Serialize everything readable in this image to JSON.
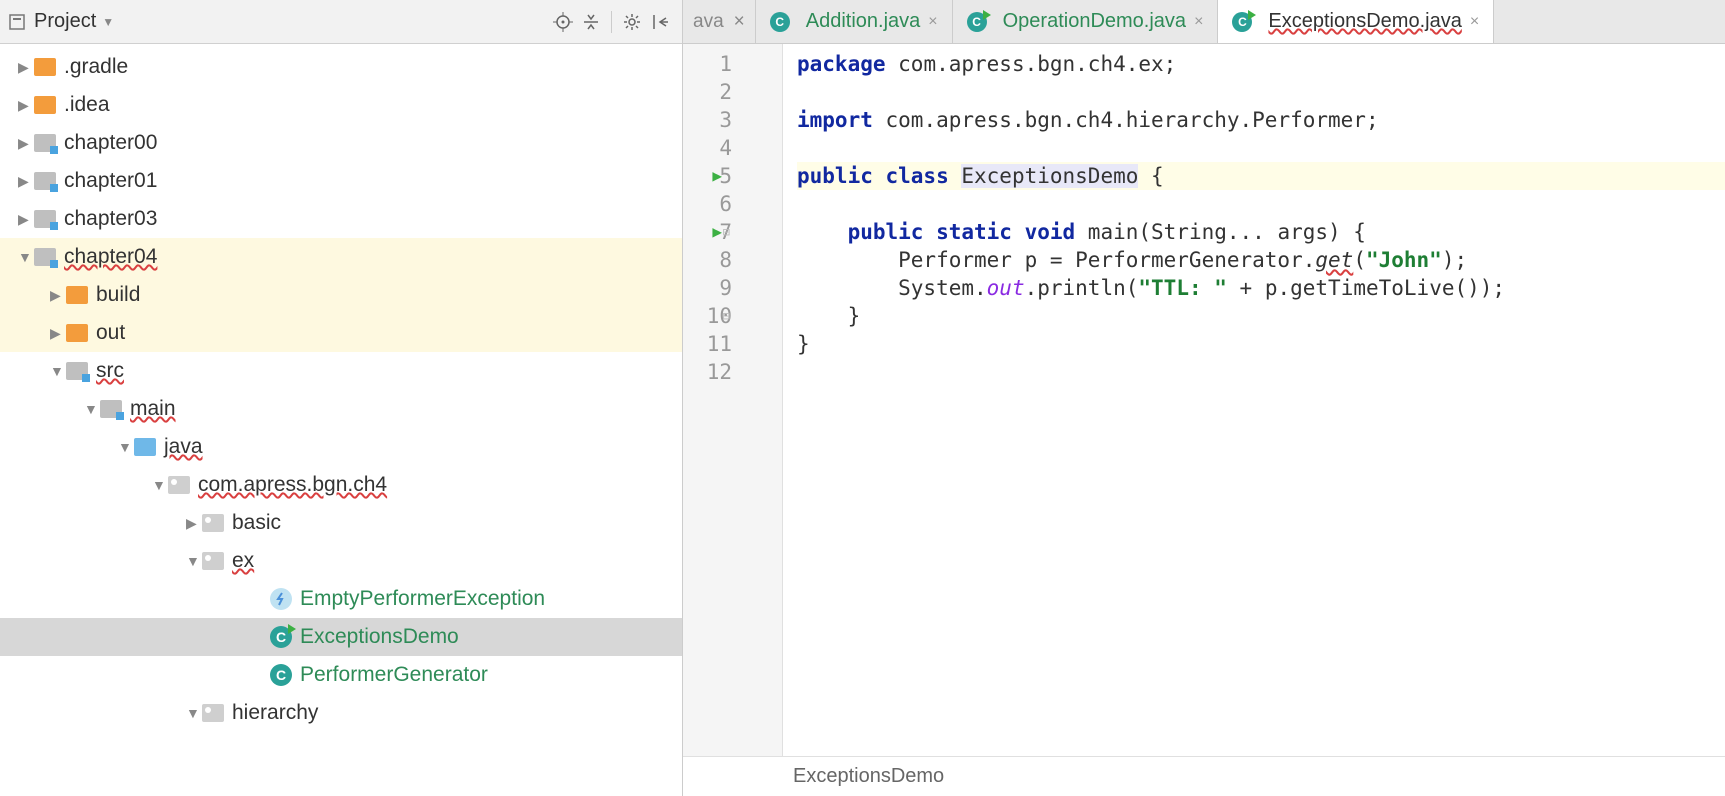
{
  "sidebar": {
    "title": "Project",
    "tree": [
      {
        "label": ".gradle",
        "icon": "folder-orange",
        "indent": 0,
        "expanded": false
      },
      {
        "label": ".idea",
        "icon": "folder-orange",
        "indent": 0,
        "expanded": false
      },
      {
        "label": "chapter00",
        "icon": "folder-gray",
        "indent": 0,
        "expanded": false
      },
      {
        "label": "chapter01",
        "icon": "folder-gray",
        "indent": 0,
        "expanded": false
      },
      {
        "label": "chapter03",
        "icon": "folder-gray",
        "indent": 0,
        "expanded": false
      },
      {
        "label": "chapter04",
        "icon": "folder-gray",
        "indent": 0,
        "expanded": true,
        "hl": true,
        "wavy": true
      },
      {
        "label": "build",
        "icon": "folder-orange",
        "indent": 1,
        "expanded": false,
        "hl": true
      },
      {
        "label": "out",
        "icon": "folder-orange",
        "indent": 1,
        "expanded": false,
        "hl": true
      },
      {
        "label": "src",
        "icon": "folder-gray",
        "indent": 1,
        "expanded": true,
        "wavy": true
      },
      {
        "label": "main",
        "icon": "folder-gray",
        "indent": 2,
        "expanded": true,
        "wavy": true
      },
      {
        "label": "java",
        "icon": "folder-blue",
        "indent": 3,
        "expanded": true,
        "wavy": true
      },
      {
        "label": "com.apress.bgn.ch4",
        "icon": "folder-pkg",
        "indent": 4,
        "expanded": true,
        "wavy": true
      },
      {
        "label": "basic",
        "icon": "folder-pkg",
        "indent": 5,
        "expanded": false
      },
      {
        "label": "ex",
        "icon": "folder-pkg",
        "indent": 5,
        "expanded": true,
        "wavy": true
      },
      {
        "label": "EmptyPerformerException",
        "icon": "exc",
        "indent": 7,
        "green": true
      },
      {
        "label": "ExceptionsDemo",
        "icon": "class-run",
        "indent": 7,
        "green": true,
        "sel": true
      },
      {
        "label": "PerformerGenerator",
        "icon": "class",
        "indent": 7,
        "green": true
      },
      {
        "label": "hierarchy",
        "icon": "folder-pkg",
        "indent": 5,
        "expanded": true
      }
    ]
  },
  "tabs": {
    "partial": "ava",
    "items": [
      {
        "label": "Addition.java",
        "icon": "class",
        "active": false,
        "green": true
      },
      {
        "label": "OperationDemo.java",
        "icon": "class-run",
        "active": false,
        "green": true
      },
      {
        "label": "ExceptionsDemo.java",
        "icon": "class-run",
        "active": true,
        "green": true,
        "wavy": true
      }
    ]
  },
  "code": {
    "lines": [
      {
        "n": 1,
        "tokens": [
          {
            "t": "package ",
            "c": "kw"
          },
          {
            "t": "com.apress.bgn.ch4.ex;",
            "c": "ident"
          }
        ]
      },
      {
        "n": 2,
        "tokens": []
      },
      {
        "n": 3,
        "tokens": [
          {
            "t": "import ",
            "c": "kw"
          },
          {
            "t": "com.apress.bgn.ch4.hierarchy.Performer;",
            "c": "ident"
          }
        ]
      },
      {
        "n": 4,
        "tokens": []
      },
      {
        "n": 5,
        "hl": true,
        "run": true,
        "tokens": [
          {
            "t": "public class ",
            "c": "kw"
          },
          {
            "t": "ExceptionsDemo",
            "c": "klass"
          },
          {
            "t": " {",
            "c": "ident"
          }
        ]
      },
      {
        "n": 6,
        "tokens": []
      },
      {
        "n": 7,
        "run": true,
        "fold": "down",
        "tokens": [
          {
            "t": "    ",
            "c": ""
          },
          {
            "t": "public static void ",
            "c": "kw"
          },
          {
            "t": "main(String... args) {",
            "c": "ident"
          }
        ]
      },
      {
        "n": 8,
        "tokens": [
          {
            "t": "        Performer p = PerformerGenerator.",
            "c": "ident"
          },
          {
            "t": "get",
            "c": "err-method"
          },
          {
            "t": "(",
            "c": "ident"
          },
          {
            "t": "\"John\"",
            "c": "str"
          },
          {
            "t": ");",
            "c": "ident"
          }
        ]
      },
      {
        "n": 9,
        "tokens": [
          {
            "t": "        System.",
            "c": "ident"
          },
          {
            "t": "out",
            "c": "field"
          },
          {
            "t": ".println(",
            "c": "ident"
          },
          {
            "t": "\"TTL: \"",
            "c": "str"
          },
          {
            "t": " + p.getTimeToLive());",
            "c": "ident"
          }
        ]
      },
      {
        "n": 10,
        "fold": "up",
        "tokens": [
          {
            "t": "    }",
            "c": "ident"
          }
        ]
      },
      {
        "n": 11,
        "tokens": [
          {
            "t": "}",
            "c": "ident"
          }
        ]
      },
      {
        "n": 12,
        "tokens": []
      }
    ]
  },
  "breadcrumb": "ExceptionsDemo"
}
